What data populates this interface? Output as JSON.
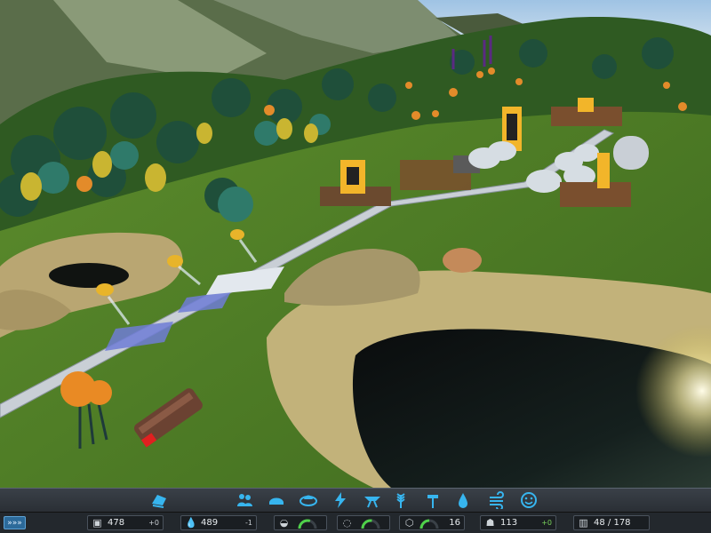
{
  "toolbar": {
    "items": [
      {
        "icon": "bulldozer-icon"
      },
      {
        "icon": "population-icon"
      },
      {
        "icon": "habitat-icon"
      },
      {
        "icon": "food-icon"
      },
      {
        "icon": "energy-icon"
      },
      {
        "icon": "drone-icon"
      },
      {
        "icon": "agriculture-icon"
      },
      {
        "icon": "terraform-icon"
      },
      {
        "icon": "water-icon"
      },
      {
        "icon": "air-icon"
      },
      {
        "icon": "happiness-icon"
      }
    ],
    "accent": "#37b5ef"
  },
  "status": {
    "speed_label": "»»»",
    "resources": [
      {
        "id": "buildings",
        "icon": "crate-icon",
        "value": "478",
        "delta": "+0"
      },
      {
        "id": "water",
        "icon": "water-drop-icon",
        "value": "489",
        "delta": "-1"
      },
      {
        "id": "food",
        "icon": "food-tray-icon",
        "gauge_fill": 0.6
      },
      {
        "id": "happiness",
        "icon": "ring-icon",
        "gauge_fill": 0.55
      },
      {
        "id": "drones",
        "icon": "drone-icon",
        "gauge_fill": 0.5,
        "value": "16"
      },
      {
        "id": "colonists",
        "icon": "colonist-icon",
        "value": "113",
        "delta": "+0"
      },
      {
        "id": "housing",
        "icon": "housing-icon",
        "value": "48 / 178"
      }
    ]
  }
}
